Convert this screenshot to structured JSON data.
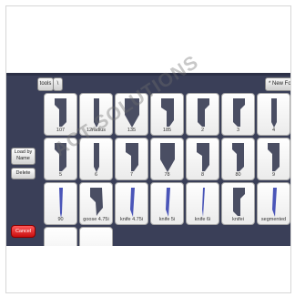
{
  "toolbar": {
    "tools_label": "tools",
    "path_separator": "\\",
    "new_folder_label": "* New Folder"
  },
  "sidebar": {
    "load_by_name_label": "Load by Name",
    "delete_label": "Delete",
    "cancel_label": "Cancel"
  },
  "tiles": [
    {
      "label": "107",
      "shape": "notch-left"
    },
    {
      "label": "12radius",
      "shape": "blade"
    },
    {
      "label": "135",
      "shape": "wedge"
    },
    {
      "label": "185",
      "shape": "step-left"
    },
    {
      "label": "2",
      "shape": "notch-right"
    },
    {
      "label": "3",
      "shape": "notch-right"
    },
    {
      "label": "4",
      "shape": "blade"
    },
    {
      "label": "5",
      "shape": "notch-left"
    },
    {
      "label": "6",
      "shape": "blade"
    },
    {
      "label": "7",
      "shape": "step-left"
    },
    {
      "label": "78",
      "shape": "wedge"
    },
    {
      "label": "8",
      "shape": "step-left"
    },
    {
      "label": "80",
      "shape": "notch-left"
    },
    {
      "label": "9",
      "shape": "notch-left"
    },
    {
      "label": "90",
      "shape": "needle"
    },
    {
      "label": "goose 4.75i",
      "shape": "goose"
    },
    {
      "label": "knife 4.75i",
      "shape": "knife"
    },
    {
      "label": "knife 5i",
      "shape": "knife"
    },
    {
      "label": "knife 6i",
      "shape": "knife-thin"
    },
    {
      "label": "knifei",
      "shape": "notch-right"
    },
    {
      "label": "segmented",
      "shape": "knife"
    }
  ],
  "watermark": "ACT-SOLUTIONS",
  "colors": {
    "app_background": "#3a3f58",
    "cancel": "#e01010",
    "tile": "#f4f4f4",
    "icon_dark": "#4a4e63",
    "icon_blade": "#4a55b8"
  }
}
